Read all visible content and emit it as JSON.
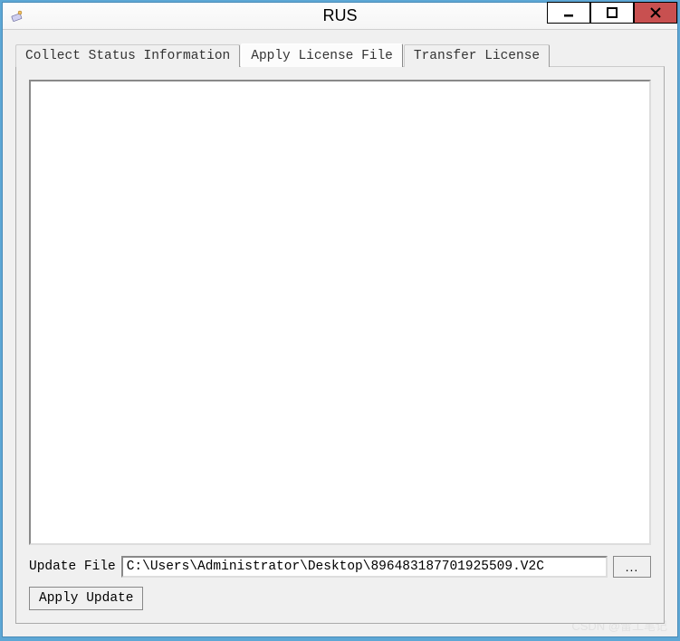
{
  "window": {
    "title": "RUS"
  },
  "tabs": {
    "collect": "Collect Status Information",
    "apply": "Apply License File",
    "transfer": "Transfer License"
  },
  "panel": {
    "file_label": "Update File",
    "file_value": "C:\\Users\\Administrator\\Desktop\\896483187701925509.V2C",
    "browse_label": "...",
    "apply_label": "Apply Update"
  },
  "watermark": "CSDN @雷工笔记"
}
